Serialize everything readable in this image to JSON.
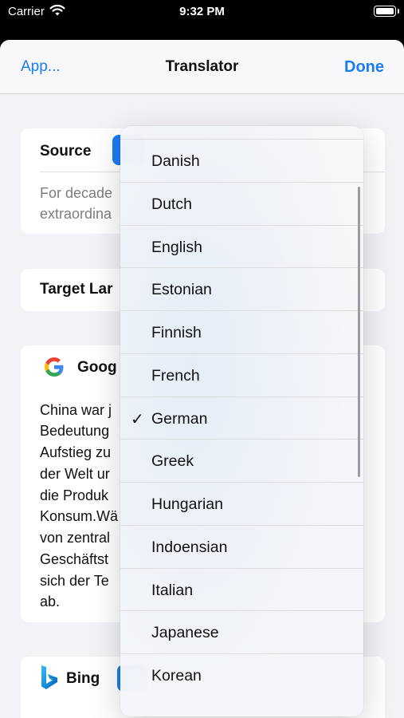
{
  "status_bar": {
    "carrier": "Carrier",
    "time": "9:32 PM"
  },
  "nav": {
    "back_label": "App...",
    "title": "Translator",
    "done_label": "Done"
  },
  "source_card": {
    "label": "Source",
    "text_lines": [
      "For decade",
      "extraordina"
    ]
  },
  "target_card": {
    "label": "Target Lar"
  },
  "google_card": {
    "label": "Goog",
    "text_lines": [
      "China war j",
      "Bedeutung",
      "Aufstieg zu",
      "der Welt ur",
      "die Produk",
      "Konsum.Wä",
      "von zentral",
      "Geschäftst",
      "sich der Te",
      "ab."
    ]
  },
  "bing_card": {
    "label": "Bing"
  },
  "language_menu": {
    "selected": "German",
    "items": [
      "Danish",
      "Dutch",
      "English",
      "Estonian",
      "Finnish",
      "French",
      "German",
      "Greek",
      "Hungarian",
      "Indoensian",
      "Italian",
      "Japanese",
      "Korean"
    ]
  },
  "colors": {
    "accent": "#1a7cf5",
    "background": "#f2f2f7"
  },
  "icons": {
    "checkmark": "✓"
  }
}
